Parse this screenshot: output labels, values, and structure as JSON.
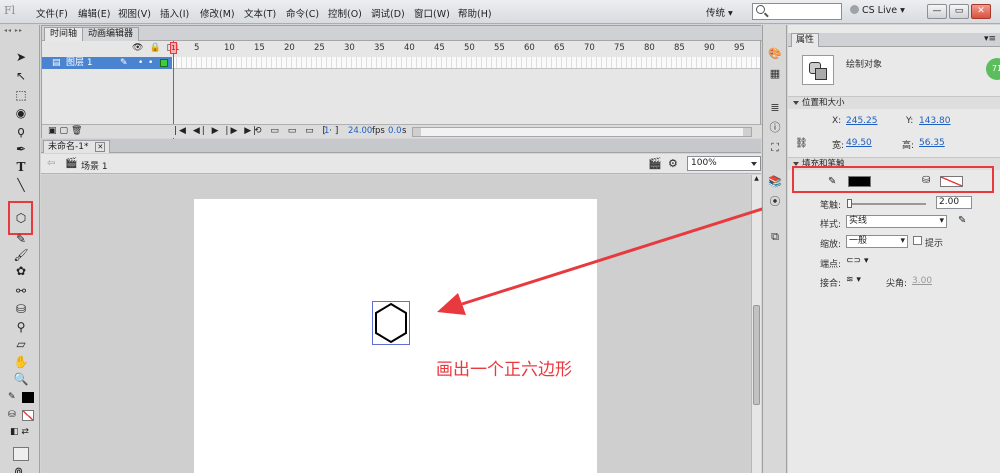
{
  "app": {
    "logo": "Fl",
    "menus": [
      "文件(F)",
      "编辑(E)",
      "视图(V)",
      "插入(I)",
      "修改(M)",
      "文本(T)",
      "命令(C)",
      "控制(O)",
      "调试(D)",
      "窗口(W)",
      "帮助(H)"
    ],
    "workspace": "传统",
    "search_placeholder": "",
    "cslive": "CS Live",
    "window_controls": [
      "—",
      "▭",
      "✕"
    ]
  },
  "timeline": {
    "tabs": [
      "时间轴",
      "动画编辑器"
    ],
    "ruler": [
      "1",
      "5",
      "10",
      "15",
      "20",
      "25",
      "30",
      "35",
      "40",
      "45",
      "50",
      "55",
      "60",
      "65",
      "70",
      "75",
      "80",
      "85",
      "90",
      "95"
    ],
    "layer_name": "图层 1",
    "current_frame": "1",
    "fps": "24.00",
    "fps_unit": "fps",
    "time": "0.0",
    "time_unit": "s"
  },
  "document": {
    "tab_title": "未命名-1*",
    "scene": "场景 1",
    "zoom": "100%"
  },
  "annotation": {
    "text": "画出一个正六边形",
    "color": "#e8393f"
  },
  "properties": {
    "tab": "属性",
    "object_type": "绘制对象",
    "badge": "71",
    "position_size": {
      "header": "位置和大小",
      "x_label": "X:",
      "x": "245.25",
      "y_label": "Y:",
      "y": "143.80",
      "w_label": "宽:",
      "w": "49.50",
      "h_label": "高:",
      "h": "56.35"
    },
    "fill_stroke": {
      "header": "填充和笔触",
      "stroke_label": "笔触:",
      "stroke_value": "2.00",
      "style_label": "样式:",
      "style_value": "实线",
      "scale_label": "缩放:",
      "scale_value": "一般",
      "hint_label": "提示",
      "cap_label": "端点:",
      "join_label": "接合:",
      "miter_label": "尖角:",
      "miter_value": "3.00",
      "stroke_color": "#000000"
    }
  }
}
